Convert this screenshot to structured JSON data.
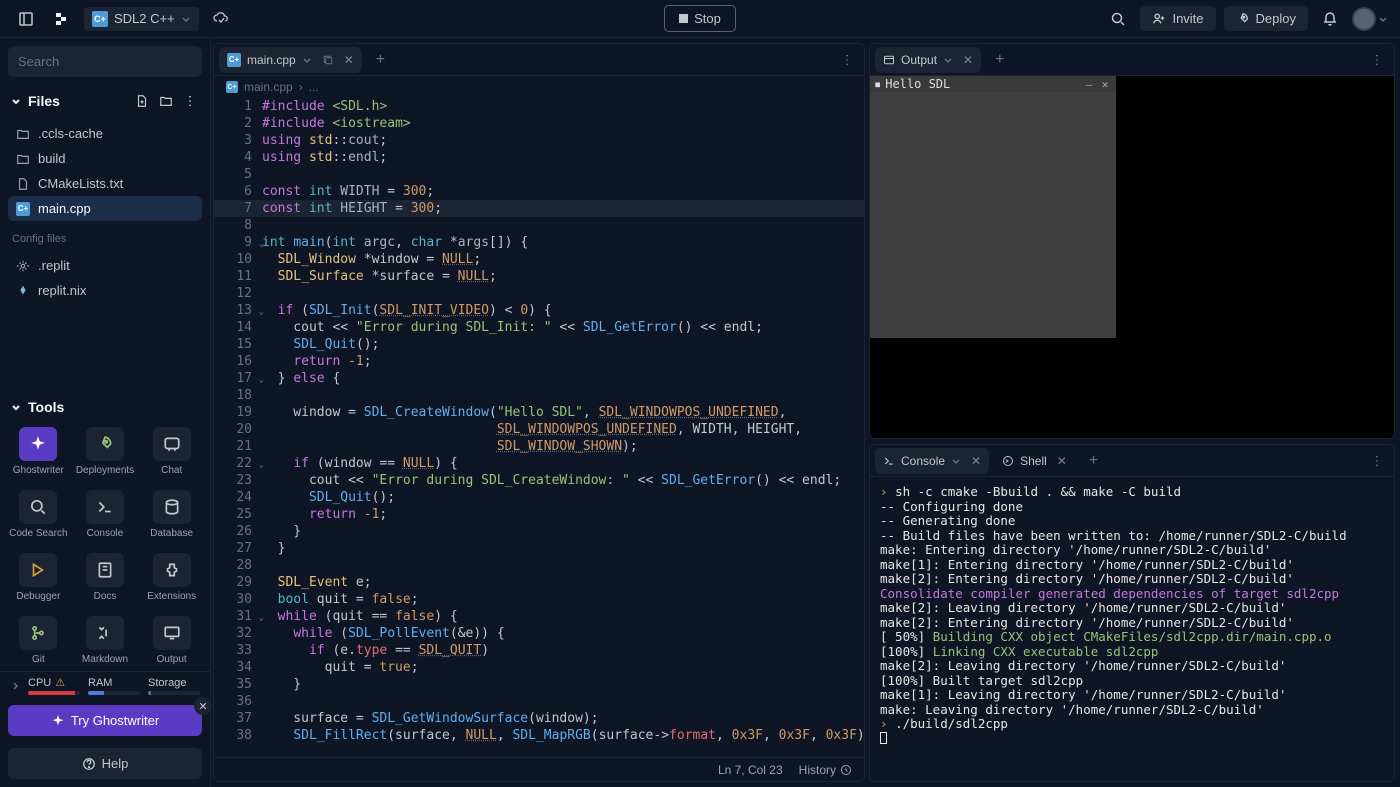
{
  "topbar": {
    "project_name": "SDL2 C++",
    "stop_label": "Stop",
    "invite_label": "Invite",
    "deploy_label": "Deploy"
  },
  "sidebar": {
    "search_placeholder": "Search",
    "files_header": "Files",
    "files": [
      {
        "name": ".ccls-cache",
        "type": "folder"
      },
      {
        "name": "build",
        "type": "folder"
      },
      {
        "name": "CMakeLists.txt",
        "type": "file"
      },
      {
        "name": "main.cpp",
        "type": "cpp",
        "active": true
      }
    ],
    "config_header": "Config files",
    "config_files": [
      {
        "name": ".replit"
      },
      {
        "name": "replit.nix"
      }
    ],
    "tools_header": "Tools",
    "tools": [
      {
        "label": "Ghostwriter"
      },
      {
        "label": "Deployments"
      },
      {
        "label": "Chat"
      },
      {
        "label": "Code Search"
      },
      {
        "label": "Console"
      },
      {
        "label": "Database"
      },
      {
        "label": "Debugger"
      },
      {
        "label": "Docs"
      },
      {
        "label": "Extensions"
      },
      {
        "label": "Git"
      },
      {
        "label": "Markdown"
      },
      {
        "label": "Output"
      }
    ],
    "resources": {
      "cpu": "CPU",
      "ram": "RAM",
      "storage": "Storage"
    },
    "ghostwriter_cta": "Try Ghostwriter",
    "help": "Help"
  },
  "editor": {
    "tab_name": "main.cpp",
    "breadcrumb": "main.cpp",
    "breadcrumb_more": "...",
    "status_pos": "Ln 7, Col 23",
    "status_history": "History"
  },
  "output": {
    "tab": "Output",
    "window_title": "Hello SDL"
  },
  "console": {
    "tabs": {
      "console": "Console",
      "shell": "Shell"
    },
    "lines": [
      {
        "t": "sh -c cmake -Bbuild . && make -C build",
        "p": true
      },
      {
        "t": "-- Configuring done"
      },
      {
        "t": "-- Generating done"
      },
      {
        "t": "-- Build files have been written to: /home/runner/SDL2-C/build"
      },
      {
        "t": "make: Entering directory '/home/runner/SDL2-C/build'"
      },
      {
        "t": "make[1]: Entering directory '/home/runner/SDL2-C/build'"
      },
      {
        "t": "make[2]: Entering directory '/home/runner/SDL2-C/build'"
      },
      {
        "t": "Consolidate compiler generated dependencies of target sdl2cpp",
        "c": "mag"
      },
      {
        "t": "make[2]: Leaving directory '/home/runner/SDL2-C/build'"
      },
      {
        "t": "make[2]: Entering directory '/home/runner/SDL2-C/build'"
      },
      {
        "pre": "[ 50%] ",
        "t": "Building CXX object CMakeFiles/sdl2cpp.dir/main.cpp.o",
        "c": "grn"
      },
      {
        "pre": "[100%] ",
        "t": "Linking CXX executable sdl2cpp",
        "c": "grn"
      },
      {
        "t": "make[2]: Leaving directory '/home/runner/SDL2-C/build'"
      },
      {
        "t": "[100%] Built target sdl2cpp"
      },
      {
        "t": "make[1]: Leaving directory '/home/runner/SDL2-C/build'"
      },
      {
        "t": "make: Leaving directory '/home/runner/SDL2-C/build'"
      },
      {
        "t": "./build/sdl2cpp",
        "p": true
      }
    ]
  },
  "code": {
    "lines": [
      {
        "n": 1,
        "h": [
          [
            "kw",
            "#include"
          ],
          [
            "op",
            " "
          ],
          [
            "inc",
            "<SDL.h>"
          ]
        ]
      },
      {
        "n": 2,
        "h": [
          [
            "kw",
            "#include"
          ],
          [
            "op",
            " "
          ],
          [
            "inc",
            "<iostream>"
          ]
        ]
      },
      {
        "n": 3,
        "h": [
          [
            "kw",
            "using"
          ],
          [
            "op",
            " "
          ],
          [
            "ty",
            "std"
          ],
          [
            "op",
            "::"
          ],
          [
            "co",
            "cout"
          ],
          [
            "op",
            ";"
          ]
        ]
      },
      {
        "n": 4,
        "h": [
          [
            "kw",
            "using"
          ],
          [
            "op",
            " "
          ],
          [
            "ty",
            "std"
          ],
          [
            "op",
            "::"
          ],
          [
            "co",
            "endl"
          ],
          [
            "op",
            ";"
          ]
        ]
      },
      {
        "n": 5,
        "h": [
          [
            "op",
            ""
          ]
        ]
      },
      {
        "n": 6,
        "h": [
          [
            "kw",
            "const"
          ],
          [
            "op",
            " "
          ],
          [
            "kw2",
            "int"
          ],
          [
            "op",
            " "
          ],
          [
            "co",
            "WIDTH"
          ],
          [
            "op",
            " = "
          ],
          [
            "nm",
            "300"
          ],
          [
            "op",
            ";"
          ]
        ]
      },
      {
        "n": 7,
        "hl": true,
        "h": [
          [
            "kw",
            "const"
          ],
          [
            "op",
            " "
          ],
          [
            "kw2",
            "int"
          ],
          [
            "op",
            " "
          ],
          [
            "co",
            "HEIGHT"
          ],
          [
            "op",
            " = "
          ],
          [
            "nm",
            "300"
          ],
          [
            "op",
            ";"
          ]
        ]
      },
      {
        "n": 8,
        "h": [
          [
            "op",
            ""
          ]
        ]
      },
      {
        "n": 9,
        "fold": true,
        "h": [
          [
            "kw2",
            "int"
          ],
          [
            "op",
            " "
          ],
          [
            "fn",
            "main"
          ],
          [
            "op",
            "("
          ],
          [
            "kw2",
            "int"
          ],
          [
            "op",
            " "
          ],
          [
            "co",
            "argc"
          ],
          [
            "op",
            ", "
          ],
          [
            "kw2",
            "char"
          ],
          [
            "op",
            " *"
          ],
          [
            "co",
            "args"
          ],
          [
            "op",
            "[]) {"
          ]
        ]
      },
      {
        "n": 10,
        "h": [
          [
            "op",
            "  "
          ],
          [
            "ty",
            "SDL_Window"
          ],
          [
            "op",
            " *window = "
          ],
          [
            "mac",
            "NULL"
          ],
          [
            "op",
            ";"
          ]
        ]
      },
      {
        "n": 11,
        "h": [
          [
            "op",
            "  "
          ],
          [
            "ty",
            "SDL_Surface"
          ],
          [
            "op",
            " *surface = "
          ],
          [
            "mac",
            "NULL"
          ],
          [
            "op",
            ";"
          ]
        ]
      },
      {
        "n": 12,
        "h": [
          [
            "op",
            ""
          ]
        ]
      },
      {
        "n": 13,
        "fold": true,
        "h": [
          [
            "op",
            "  "
          ],
          [
            "kw",
            "if"
          ],
          [
            "op",
            " ("
          ],
          [
            "fn",
            "SDL_Init"
          ],
          [
            "op",
            "("
          ],
          [
            "mac",
            "SDL_INIT_VIDEO"
          ],
          [
            "op",
            ") < "
          ],
          [
            "nm",
            "0"
          ],
          [
            "op",
            ") {"
          ]
        ]
      },
      {
        "n": 14,
        "h": [
          [
            "op",
            "    cout << "
          ],
          [
            "st",
            "\"Error during SDL_Init: \""
          ],
          [
            "op",
            " << "
          ],
          [
            "fn",
            "SDL_GetError"
          ],
          [
            "op",
            "() << endl;"
          ]
        ]
      },
      {
        "n": 15,
        "h": [
          [
            "op",
            "    "
          ],
          [
            "fn",
            "SDL_Quit"
          ],
          [
            "op",
            "();"
          ]
        ]
      },
      {
        "n": 16,
        "h": [
          [
            "op",
            "    "
          ],
          [
            "kw",
            "return"
          ],
          [
            "op",
            " "
          ],
          [
            "nm",
            "-1"
          ],
          [
            "op",
            ";"
          ]
        ]
      },
      {
        "n": 17,
        "fold": true,
        "h": [
          [
            "op",
            "  } "
          ],
          [
            "kw",
            "else"
          ],
          [
            "op",
            " {"
          ]
        ]
      },
      {
        "n": 18,
        "h": [
          [
            "op",
            ""
          ]
        ]
      },
      {
        "n": 19,
        "h": [
          [
            "op",
            "    window = "
          ],
          [
            "fn",
            "SDL_CreateWindow"
          ],
          [
            "op",
            "("
          ],
          [
            "st",
            "\"Hello SDL\""
          ],
          [
            "op",
            ", "
          ],
          [
            "mac",
            "SDL_WINDOWPOS_UNDEFINED"
          ],
          [
            "op",
            ","
          ]
        ]
      },
      {
        "n": 20,
        "h": [
          [
            "op",
            "                              "
          ],
          [
            "mac",
            "SDL_WINDOWPOS_UNDEFINED"
          ],
          [
            "op",
            ", WIDTH, HEIGHT,"
          ]
        ]
      },
      {
        "n": 21,
        "h": [
          [
            "op",
            "                              "
          ],
          [
            "mac",
            "SDL_WINDOW_SHOWN"
          ],
          [
            "op",
            ");"
          ]
        ]
      },
      {
        "n": 22,
        "fold": true,
        "h": [
          [
            "op",
            "    "
          ],
          [
            "kw",
            "if"
          ],
          [
            "op",
            " (window == "
          ],
          [
            "mac",
            "NULL"
          ],
          [
            "op",
            ") {"
          ]
        ]
      },
      {
        "n": 23,
        "h": [
          [
            "op",
            "      cout << "
          ],
          [
            "st",
            "\"Error during SDL_CreateWindow: \""
          ],
          [
            "op",
            " << "
          ],
          [
            "fn",
            "SDL_GetError"
          ],
          [
            "op",
            "() << endl;"
          ]
        ]
      },
      {
        "n": 24,
        "h": [
          [
            "op",
            "      "
          ],
          [
            "fn",
            "SDL_Quit"
          ],
          [
            "op",
            "();"
          ]
        ]
      },
      {
        "n": 25,
        "h": [
          [
            "op",
            "      "
          ],
          [
            "kw",
            "return"
          ],
          [
            "op",
            " "
          ],
          [
            "nm",
            "-1"
          ],
          [
            "op",
            ";"
          ]
        ]
      },
      {
        "n": 26,
        "h": [
          [
            "op",
            "    }"
          ]
        ]
      },
      {
        "n": 27,
        "h": [
          [
            "op",
            "  }"
          ]
        ]
      },
      {
        "n": 28,
        "h": [
          [
            "op",
            ""
          ]
        ]
      },
      {
        "n": 29,
        "h": [
          [
            "op",
            "  "
          ],
          [
            "ty",
            "SDL_Event"
          ],
          [
            "op",
            " e;"
          ]
        ]
      },
      {
        "n": 30,
        "h": [
          [
            "op",
            "  "
          ],
          [
            "kw2",
            "bool"
          ],
          [
            "op",
            " quit = "
          ],
          [
            "nm",
            "false"
          ],
          [
            "op",
            ";"
          ]
        ]
      },
      {
        "n": 31,
        "fold": true,
        "h": [
          [
            "op",
            "  "
          ],
          [
            "kw",
            "while"
          ],
          [
            "op",
            " (quit == "
          ],
          [
            "nm",
            "false"
          ],
          [
            "op",
            ") {"
          ]
        ]
      },
      {
        "n": 32,
        "h": [
          [
            "op",
            "    "
          ],
          [
            "kw",
            "while"
          ],
          [
            "op",
            " ("
          ],
          [
            "fn",
            "SDL_PollEvent"
          ],
          [
            "op",
            "(&e)) {"
          ]
        ]
      },
      {
        "n": 33,
        "h": [
          [
            "op",
            "      "
          ],
          [
            "kw",
            "if"
          ],
          [
            "op",
            " (e."
          ],
          [
            "id",
            "type"
          ],
          [
            "op",
            " == "
          ],
          [
            "mac",
            "SDL_QUIT"
          ],
          [
            "op",
            ")"
          ]
        ]
      },
      {
        "n": 34,
        "h": [
          [
            "op",
            "        quit = "
          ],
          [
            "nm",
            "true"
          ],
          [
            "op",
            ";"
          ]
        ]
      },
      {
        "n": 35,
        "h": [
          [
            "op",
            "    }"
          ]
        ]
      },
      {
        "n": 36,
        "h": [
          [
            "op",
            ""
          ]
        ]
      },
      {
        "n": 37,
        "h": [
          [
            "op",
            "    surface = "
          ],
          [
            "fn",
            "SDL_GetWindowSurface"
          ],
          [
            "op",
            "(window);"
          ]
        ]
      },
      {
        "n": 38,
        "h": [
          [
            "op",
            "    "
          ],
          [
            "fn",
            "SDL_FillRect"
          ],
          [
            "op",
            "(surface, "
          ],
          [
            "mac",
            "NULL"
          ],
          [
            "op",
            ", "
          ],
          [
            "fn",
            "SDL_MapRGB"
          ],
          [
            "op",
            "(surface->"
          ],
          [
            "id",
            "format"
          ],
          [
            "op",
            ", "
          ],
          [
            "nm",
            "0x3F"
          ],
          [
            "op",
            ", "
          ],
          [
            "nm",
            "0x3F"
          ],
          [
            "op",
            ", "
          ],
          [
            "nm",
            "0x3F"
          ],
          [
            "op",
            "));"
          ]
        ]
      }
    ]
  }
}
